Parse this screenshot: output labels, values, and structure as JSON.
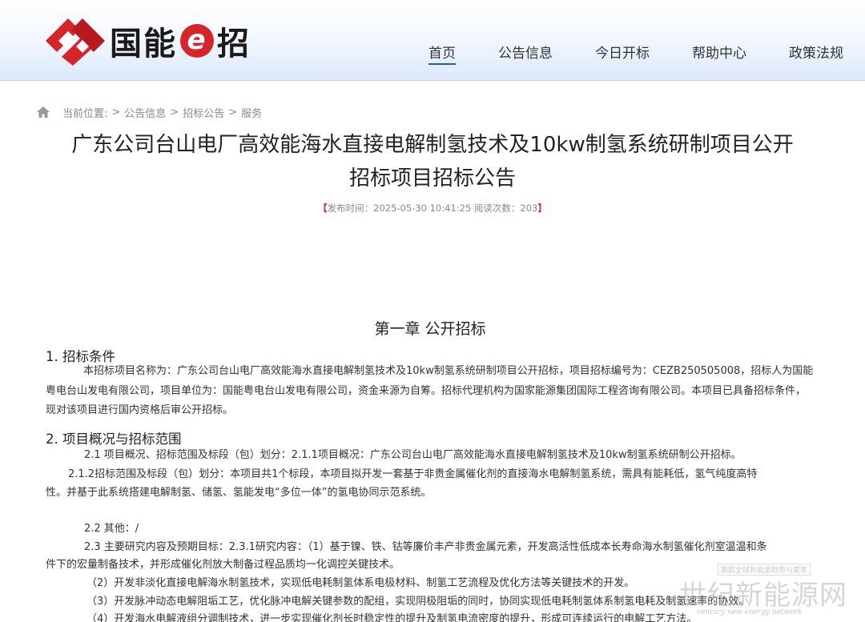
{
  "brand": {
    "name_part1": "国能",
    "name_e": "e",
    "name_part2": "招",
    "colors": {
      "logo_red": "#d6252a",
      "nav_underline": "#2a5caa"
    }
  },
  "nav": {
    "items": [
      {
        "label": "首页",
        "active": true
      },
      {
        "label": "公告信息",
        "active": false
      },
      {
        "label": "今日开标",
        "active": false
      },
      {
        "label": "帮助中心",
        "active": false
      },
      {
        "label": "政策法规",
        "active": false
      }
    ]
  },
  "breadcrumb": {
    "icon": "home-icon",
    "prefix": "当前位置:",
    "sep": ">",
    "items": [
      "公告信息",
      "招标公告",
      "服务"
    ]
  },
  "article": {
    "title_line1": "广东公司台山电厂高效能海水直接电解制氢技术及10kw制氢系统研制项目公开",
    "title_line2": "招标项目招标公告",
    "meta_open": "【",
    "meta_text": "发布时间：2025-05-30 10:41:25 阅读次数：203",
    "meta_close": "】"
  },
  "content": {
    "chapter": "第一章  公开招标",
    "sec1_title": "1. 招标条件",
    "sec1_para": "本招标项目名称为：广东公司台山电厂高效能海水直接电解制氢技术及10kw制氢系统研制项目公开招标，项目招标编号为：CEZB250505008，招标人为国能粤电台山发电有限公司，项目单位为：国能粤电台山发电有限公司，资金来源为自筹。招标代理机构为国家能源集团国际工程咨询有限公司。本项目已具备招标条件，现对该项目进行国内资格后审公开招标。",
    "sec2_title": "2. 项目概况与招标范围",
    "l1": "2.1 项目概况、招标范围及标段（包）划分：2.1.1项目概况：广东公司台山电厂高效能海水直接电解制氢技术及10kw制氢系统研制公开招标。",
    "l2a": "2.1.2招标范围及标段（包）划分：本项目共1个标段，本项目拟开发一套基于非贵金属催化剂的直接海水电解制氢系统，需具有能耗低，氢气纯度高特",
    "l2b": "性。并基于此系统搭建电解制氢、储氢、氢能发电“多位一体”的氢电协同示范系统。",
    "l3": "2.2 其他：/",
    "l4a": "2.3 主要研究内容及预期目标：2.3.1研究内容：（1）基于镍、铁、钴等廉价丰产非贵金属元素，开发高活性低成本长寿命海水制氢催化剂室温温和条",
    "l4b": "件下的宏量制备技术，并形成催化剂放大制备过程品质均一化调控关键技术。",
    "l5": "（2）开发非淡化直接电解海水制氢技术，实现低电耗制氢体系电极材料、制氢工艺流程及优化方法等关键技术的开发。",
    "l6": "（3）开发脉冲动态电解阻垢工艺，优化脉冲电解关键参数的配组，实现阴极阻垢的同时，协同实现低电耗制氢体系制氢电耗及制氢速率的协效。",
    "l7": "（4）开发海水电解液组分调制技术，进一步实现催化剂长时稳定性的提升及制氢电流密度的提升，形成可连续运行的电解工艺方法。"
  },
  "watermark": {
    "top": "跟踪全球新能源趋势与变革",
    "main": "世纪新能源网",
    "sub": "century new energy network"
  }
}
